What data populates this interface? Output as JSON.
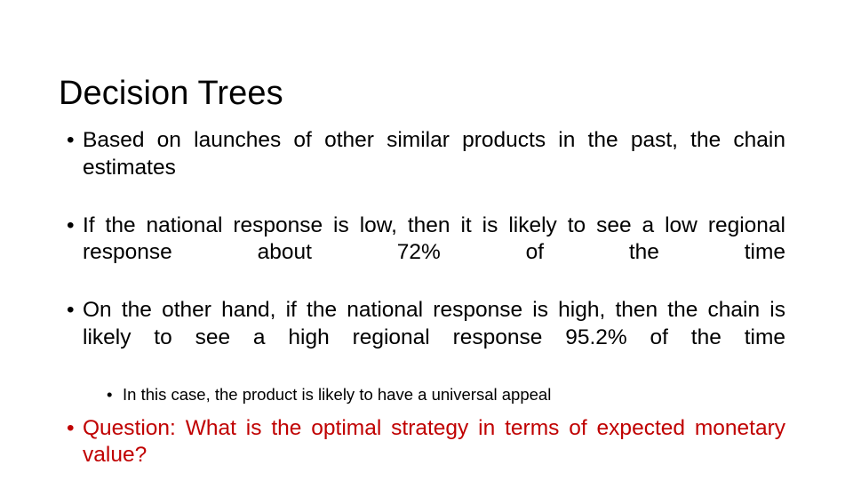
{
  "slide": {
    "title": "Decision Trees",
    "background_color": "#FFFFFF",
    "text_color": "#000000",
    "accent_color": "#C00000",
    "bullet_glyph": "•",
    "bullets": [
      {
        "level": 1,
        "text": "Based on launches of other similar products in the past, the chain estimates",
        "color": "#000000"
      },
      {
        "level": 1,
        "text": "If the national response is low, then it is likely to see a low regional response about 72% of the time",
        "color": "#000000"
      },
      {
        "level": 1,
        "text": "On the other hand, if the national response is high, then the chain is likely to see a high regional response 95.2% of the time",
        "color": "#000000"
      },
      {
        "level": 2,
        "text": "In this case, the product is likely to have a universal appeal",
        "color": "#000000"
      },
      {
        "level": 1,
        "text": "Question: What is the optimal strategy in terms of expected monetary value?",
        "color": "#C00000"
      }
    ]
  }
}
